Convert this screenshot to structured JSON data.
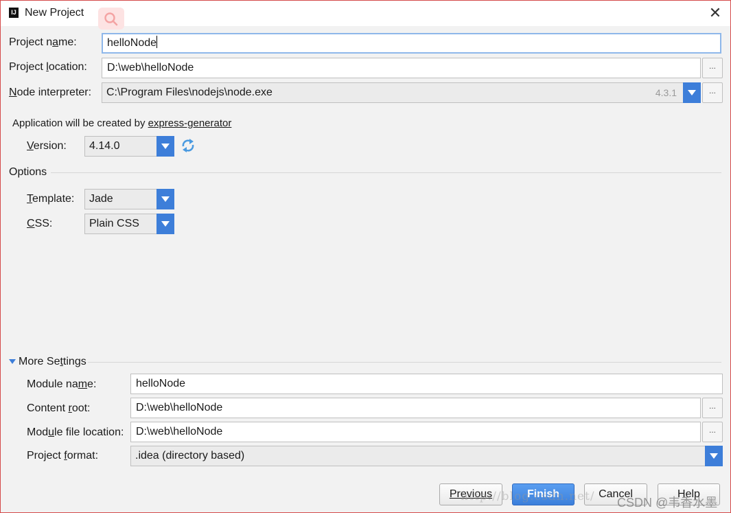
{
  "window": {
    "title": "New Project"
  },
  "form": {
    "project_name_label": "Project name:",
    "project_name_value": "helloNode",
    "project_location_label": "Project location:",
    "project_location_value": "D:\\web\\helloNode",
    "node_interpreter_label": "Node interpreter:",
    "node_interpreter_value": "C:\\Program Files\\nodejs\\node.exe",
    "node_version": "4.3.1",
    "browse_label": "..."
  },
  "generator": {
    "text": "Application will be created by",
    "link": "express-generator",
    "version_label": "Version:",
    "version_value": "4.14.0"
  },
  "options": {
    "title": "Options",
    "template_label": "Template:",
    "template_value": "Jade",
    "css_label": "CSS:",
    "css_value": "Plain CSS"
  },
  "more_settings": {
    "title": "More Settings",
    "module_name_label": "Module name:",
    "module_name_value": "helloNode",
    "content_root_label": "Content root:",
    "content_root_value": "D:\\web\\helloNode",
    "module_file_label": "Module file location:",
    "module_file_value": "D:\\web\\helloNode",
    "project_format_label": "Project format:",
    "project_format_value": ".idea (directory based)"
  },
  "buttons": {
    "previous": "Previous",
    "finish": "Finish",
    "cancel": "Cancel",
    "help": "Help"
  },
  "watermark": {
    "url": "http://blog.csdn.net/",
    "csdn": "CSDN @韦香水墨"
  },
  "colors": {
    "accent": "#3d7ed9",
    "focus": "#8eb7ea",
    "border": "#d44a4a"
  },
  "icons": {
    "app": "intellij-icon",
    "search": "search-icon",
    "close": "close-icon",
    "refresh": "refresh-icon"
  }
}
